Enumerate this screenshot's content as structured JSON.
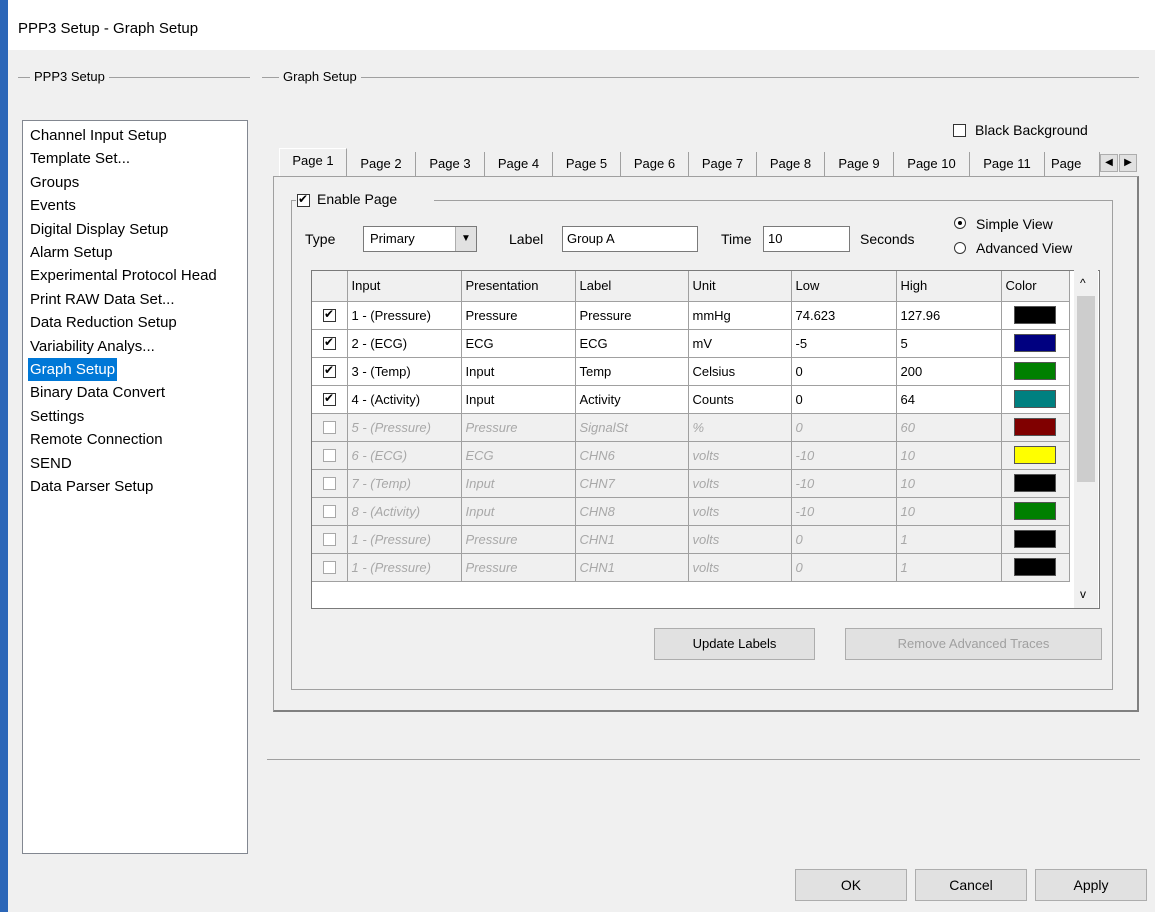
{
  "window": {
    "title": "PPP3 Setup - Graph Setup"
  },
  "left_group": {
    "title": "PPP3 Setup"
  },
  "right_group": {
    "title": "Graph Setup"
  },
  "nav_items": [
    "Channel Input Setup",
    "Template Set...",
    "Groups",
    "Events",
    "Digital Display Setup",
    "Alarm Setup",
    "Experimental Protocol Head",
    "Print RAW Data Set...",
    "Data Reduction Setup",
    "Variability Analys...",
    "Graph Setup",
    "Binary Data Convert",
    "Settings",
    "Remote Connection",
    "SEND",
    "Data Parser Setup"
  ],
  "selected_nav": "Graph Setup",
  "black_background": {
    "label": "Black Background",
    "checked": false
  },
  "tabs": [
    "Page 1",
    "Page 2",
    "Page 3",
    "Page 4",
    "Page 5",
    "Page 6",
    "Page 7",
    "Page 8",
    "Page 9",
    "Page 10",
    "Page 11",
    "Page"
  ],
  "active_tab": "Page 1",
  "enable_page": {
    "label": "Enable Page",
    "checked": true
  },
  "type": {
    "label": "Type",
    "value": "Primary"
  },
  "label_field": {
    "label": "Label",
    "value": "Group A"
  },
  "time_field": {
    "label": "Time",
    "value": "10",
    "unit": "Seconds"
  },
  "view": {
    "simple": "Simple View",
    "advanced": "Advanced View",
    "selected": "Simple View"
  },
  "grid": {
    "columns": [
      "",
      "Input",
      "Presentation",
      "Label",
      "Unit",
      "Low",
      "High",
      "Color"
    ],
    "rows": [
      {
        "enabled": true,
        "input": "1 - (Pressure)",
        "presentation": "Pressure",
        "label": "Pressure",
        "unit": "mmHg",
        "low": "74.623",
        "high": "127.96",
        "color": "#000000"
      },
      {
        "enabled": true,
        "input": "2 - (ECG)",
        "presentation": "ECG",
        "label": "ECG",
        "unit": "mV",
        "low": "-5",
        "high": "5",
        "color": "#000080"
      },
      {
        "enabled": true,
        "input": "3 - (Temp)",
        "presentation": "Input",
        "label": "Temp",
        "unit": "Celsius",
        "low": "0",
        "high": "200",
        "color": "#008000"
      },
      {
        "enabled": true,
        "input": "4 - (Activity)",
        "presentation": "Input",
        "label": "Activity",
        "unit": "Counts",
        "low": "0",
        "high": "64",
        "color": "#008080"
      },
      {
        "enabled": false,
        "input": "5 - (Pressure)",
        "presentation": "Pressure",
        "label": "SignalSt",
        "unit": "%",
        "low": "0",
        "high": "60",
        "color": "#800000"
      },
      {
        "enabled": false,
        "input": "6 - (ECG)",
        "presentation": "ECG",
        "label": "CHN6",
        "unit": "volts",
        "low": "-10",
        "high": "10",
        "color": "#ffff00"
      },
      {
        "enabled": false,
        "input": "7 - (Temp)",
        "presentation": "Input",
        "label": "CHN7",
        "unit": "volts",
        "low": "-10",
        "high": "10",
        "color": "#000000"
      },
      {
        "enabled": false,
        "input": "8 - (Activity)",
        "presentation": "Input",
        "label": "CHN8",
        "unit": "volts",
        "low": "-10",
        "high": "10",
        "color": "#008000"
      },
      {
        "enabled": false,
        "input": "1 - (Pressure)",
        "presentation": "Pressure",
        "label": "CHN1",
        "unit": "volts",
        "low": "0",
        "high": "1",
        "color": "#000000"
      },
      {
        "enabled": false,
        "input": "1 - (Pressure)",
        "presentation": "Pressure",
        "label": "CHN1",
        "unit": "volts",
        "low": "0",
        "high": "1",
        "color": "#000000"
      }
    ]
  },
  "buttons": {
    "update_labels": "Update Labels",
    "remove_advanced": "Remove Advanced Traces",
    "ok": "OK",
    "cancel": "Cancel",
    "apply": "Apply"
  }
}
